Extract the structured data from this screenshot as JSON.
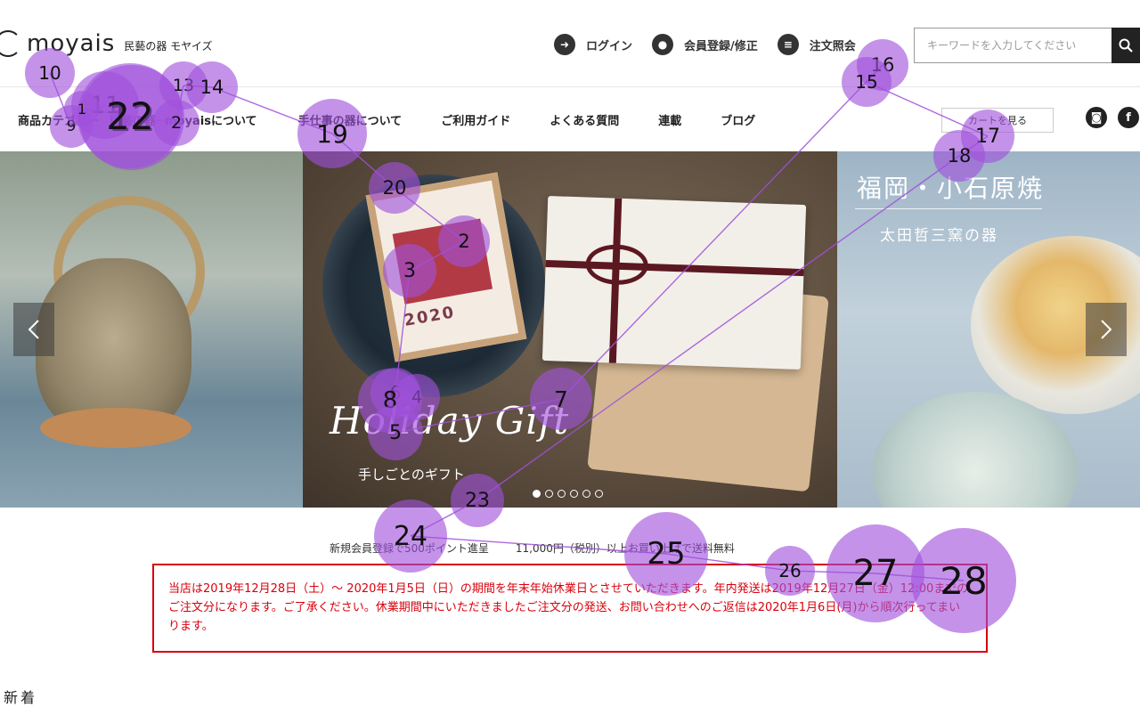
{
  "brand": {
    "logo_text": "moyais",
    "logo_sub": "民藝の器 モヤイズ"
  },
  "header": {
    "links": [
      {
        "label": "ログイン",
        "icon": "login-icon",
        "glyph": "➜"
      },
      {
        "label": "会員登録/修正",
        "icon": "user-icon",
        "glyph": "●"
      },
      {
        "label": "注文照会",
        "icon": "list-icon",
        "glyph": "≡"
      }
    ],
    "search_placeholder": "キーワードを入力してください",
    "search_value": ""
  },
  "nav": {
    "items": [
      "商品カテゴリー",
      "民藝の器",
      "moyaisについて",
      "手仕事の器について",
      "ご利用ガイド",
      "よくある質問",
      "連載",
      "ブログ"
    ],
    "cart_label": "カートを見る",
    "social": [
      {
        "name": "instagram-icon",
        "glyph": "◙"
      },
      {
        "name": "facebook-icon",
        "glyph": "f"
      }
    ]
  },
  "slider": {
    "main_title": "Holiday Gift",
    "main_subtitle": "手しごとのギフト",
    "card_text": "2020",
    "right_title": "福岡・小石原焼",
    "right_subtitle": "太田哲三窯の器",
    "prev_glyph": "‹",
    "next_glyph": "›",
    "slide_count": 6,
    "active_index": 0
  },
  "promo": {
    "left": "新規会員登録で500ポイント進呈",
    "right": "11,000円（税別）以上お買い上げで送料無料"
  },
  "notice": {
    "text": "当店は2019年12月28日（土）〜 2020年1月5日（日）の期間を年末年始休業日とさせていただきます。年内発送は2019年12月27日（金）12:00までのご注文分になります。ご了承ください。休業期間中にいただきましたご注文分の発送、お問い合わせへのご返信は2020年1月6日(月)から順次行ってまいります。"
  },
  "section": {
    "new_heading": "新着"
  },
  "gaze_overlay": {
    "fill_color": "#a050dc",
    "points": [
      {
        "n": "10"
      },
      {
        "n": "9"
      },
      {
        "n": "11"
      },
      {
        "n": "12"
      },
      {
        "n": "22"
      },
      {
        "n": "1"
      },
      {
        "n": "2"
      },
      {
        "n": "13"
      },
      {
        "n": "14"
      },
      {
        "n": "19"
      },
      {
        "n": "20"
      },
      {
        "n": "2"
      },
      {
        "n": "3"
      },
      {
        "n": "6"
      },
      {
        "n": "4"
      },
      {
        "n": "8"
      },
      {
        "n": "5"
      },
      {
        "n": "7"
      },
      {
        "n": "16"
      },
      {
        "n": "15"
      },
      {
        "n": "17"
      },
      {
        "n": "18"
      },
      {
        "n": "23"
      },
      {
        "n": "24"
      },
      {
        "n": "25"
      },
      {
        "n": "26"
      },
      {
        "n": "27"
      },
      {
        "n": "28"
      }
    ]
  }
}
